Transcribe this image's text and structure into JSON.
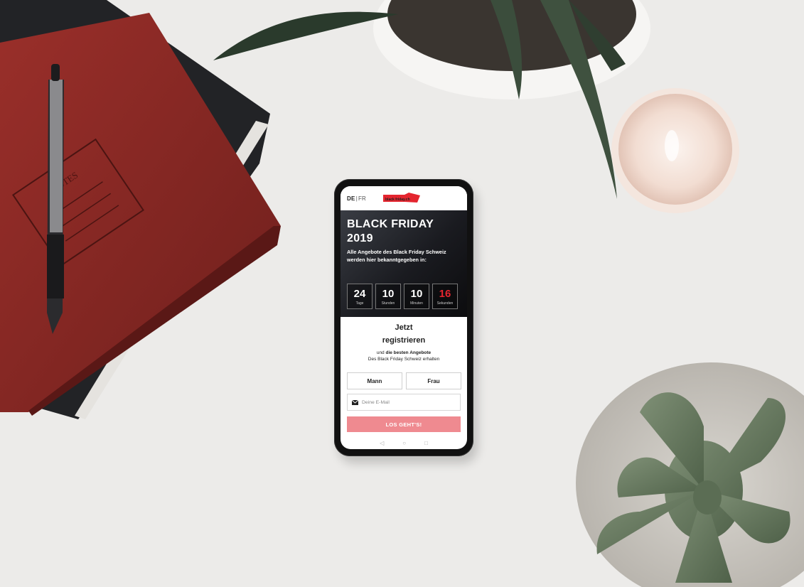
{
  "phone": {
    "lang_de": "DE",
    "lang_sep": "|",
    "lang_fr": "FR",
    "logo_text": "black friday.ch",
    "hero_title_1": "BLACK FRIDAY",
    "hero_title_2": "2019",
    "hero_subtitle_1": "Alle Angebote des Black Friday Schweiz",
    "hero_subtitle_2": "werden hier bekanntgegeben in:",
    "countdown": [
      {
        "value": "24",
        "unit": "Tage"
      },
      {
        "value": "10",
        "unit": "Stunden"
      },
      {
        "value": "10",
        "unit": "Minuten"
      },
      {
        "value": "16",
        "unit": "Sekunden"
      }
    ],
    "register_title_1": "Jetzt",
    "register_title_2": "registrieren",
    "register_line_1a": "und ",
    "register_line_1b": "die besten Angebote",
    "register_line_2": "Des Black Friday Schweiz erhalten",
    "btn_mann": "Mann",
    "btn_frau": "Frau",
    "email_placeholder": "Deine E-Mail",
    "cta_label": "LOS GEHT'S!"
  },
  "colors": {
    "accent_red": "#e4252f",
    "cta_pink": "#ef8a90",
    "table": "#e9e8e6",
    "notebook_red": "#8a2a26"
  },
  "icons": [
    "envelope-icon",
    "back-icon",
    "home-icon",
    "recent-apps-icon"
  ]
}
